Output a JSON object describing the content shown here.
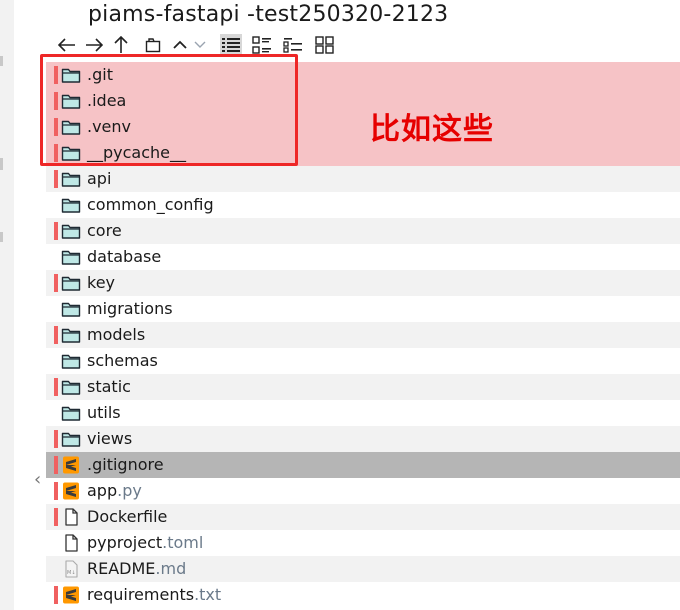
{
  "window_title": "piams-fastapi -test250320-2123",
  "annotation": "比如这些",
  "toolbar": {
    "back": "back-icon",
    "forward": "forward-icon",
    "up": "up-icon",
    "new_folder": "new-folder-icon",
    "collapse": "collapse-icon",
    "expand": "expand-icon",
    "view_modes": [
      "details-view-icon",
      "list-view-icon",
      "tiles-view-icon",
      "grid-view-icon"
    ],
    "selected_view": "details-view-icon"
  },
  "colors": {
    "highlight_row": "#f6c3c6",
    "stripe_row": "#f2f2f2",
    "selected_row": "#b5b5b5",
    "status_red": "#f06060",
    "folder_fill": "#bfe8e6",
    "annotation_red": "#e60000"
  },
  "files": [
    {
      "name": ".git",
      "ext": "",
      "type": "folder",
      "state": "highlighted"
    },
    {
      "name": ".idea",
      "ext": "",
      "type": "folder",
      "state": "highlighted"
    },
    {
      "name": ".venv",
      "ext": "",
      "type": "folder",
      "state": "highlighted"
    },
    {
      "name": "__pycache__",
      "ext": "",
      "type": "folder",
      "state": "highlighted"
    },
    {
      "name": "api",
      "ext": "",
      "type": "folder",
      "state": "stripe"
    },
    {
      "name": "common_config",
      "ext": "",
      "type": "folder",
      "state": "normal"
    },
    {
      "name": "core",
      "ext": "",
      "type": "folder",
      "state": "stripe"
    },
    {
      "name": "database",
      "ext": "",
      "type": "folder",
      "state": "normal"
    },
    {
      "name": "key",
      "ext": "",
      "type": "folder",
      "state": "stripe"
    },
    {
      "name": "migrations",
      "ext": "",
      "type": "folder",
      "state": "normal"
    },
    {
      "name": "models",
      "ext": "",
      "type": "folder",
      "state": "stripe"
    },
    {
      "name": "schemas",
      "ext": "",
      "type": "folder",
      "state": "normal"
    },
    {
      "name": "static",
      "ext": "",
      "type": "folder",
      "state": "stripe"
    },
    {
      "name": "utils",
      "ext": "",
      "type": "folder",
      "state": "normal"
    },
    {
      "name": "views",
      "ext": "",
      "type": "folder",
      "state": "stripe"
    },
    {
      "name": ".gitignore",
      "ext": "",
      "type": "sublime",
      "state": "selected"
    },
    {
      "name": "app",
      "ext": ".py",
      "type": "sublime",
      "state": "normal"
    },
    {
      "name": "Dockerfile",
      "ext": "",
      "type": "file",
      "state": "stripe"
    },
    {
      "name": "pyproject",
      "ext": ".toml",
      "type": "file",
      "state": "normal"
    },
    {
      "name": "README",
      "ext": ".md",
      "type": "markdown",
      "state": "stripe"
    },
    {
      "name": "requirements",
      "ext": ".txt",
      "type": "sublime",
      "state": "normal"
    }
  ]
}
